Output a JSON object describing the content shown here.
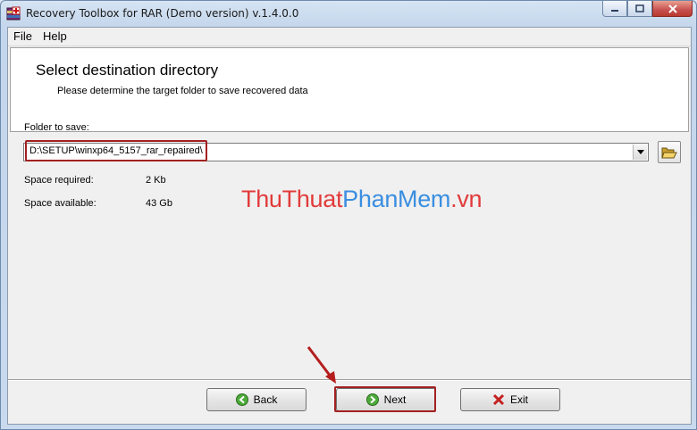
{
  "window": {
    "title": "Recovery Toolbox for RAR (Demo version) v.1.4.0.0",
    "caption_buttons": [
      "minimize",
      "maximize",
      "close"
    ]
  },
  "menu": [
    "File",
    "Help"
  ],
  "header": {
    "title": "Select destination directory",
    "subtitle": "Please determine the target folder to save recovered data"
  },
  "folder": {
    "label": "Folder to save:",
    "value": "D:\\SETUP\\winxp64_5157_rar_repaired\\"
  },
  "space": {
    "required_label": "Space required:",
    "required_value": "2 Kb",
    "available_label": "Space available:",
    "available_value": "43 Gb"
  },
  "watermark": {
    "part1": "ThuThuat",
    "part2": "PhanMem",
    "part3": ".vn"
  },
  "buttons": {
    "back": "Back",
    "next": "Next",
    "exit": "Exit"
  },
  "annotation_color": "#a32020"
}
